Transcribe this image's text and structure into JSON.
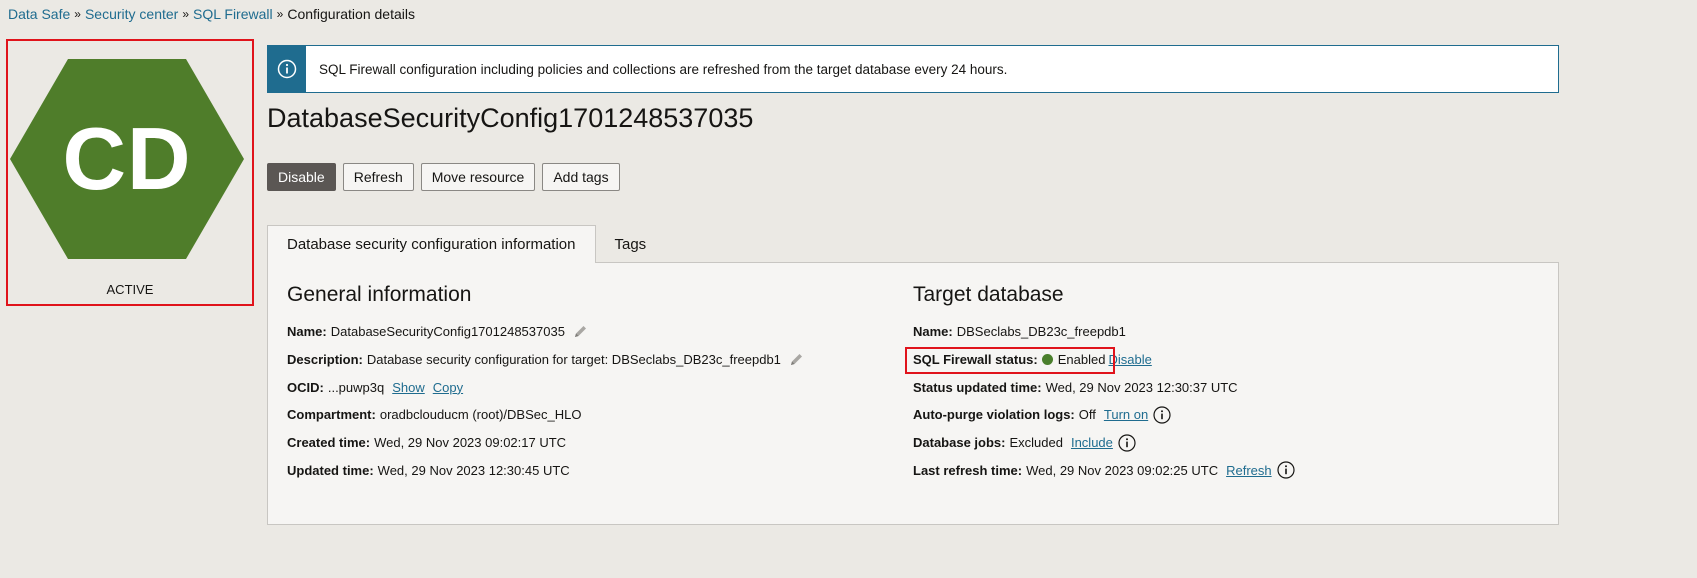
{
  "breadcrumb": {
    "items": [
      "Data Safe",
      "Security center",
      "SQL Firewall"
    ],
    "current": "Configuration details",
    "separator": "»"
  },
  "resource": {
    "initials": "CD",
    "status": "ACTIVE",
    "color": "#4f7d2a"
  },
  "banner": {
    "message": "SQL Firewall configuration including policies and collections are refreshed from the target database every 24 hours."
  },
  "page": {
    "title": "DatabaseSecurityConfig1701248537035"
  },
  "actions": {
    "disable": "Disable",
    "refresh": "Refresh",
    "move_resource": "Move resource",
    "add_tags": "Add tags"
  },
  "tabs": {
    "info": "Database security configuration information",
    "tags": "Tags"
  },
  "general": {
    "heading": "General information",
    "name_label": "Name:",
    "name_value": "DatabaseSecurityConfig1701248537035",
    "description_label": "Description:",
    "description_value": "Database security configuration for target: DBSeclabs_DB23c_freepdb1",
    "ocid_label": "OCID:",
    "ocid_value": "...puwp3q",
    "ocid_show": "Show",
    "ocid_copy": "Copy",
    "compartment_label": "Compartment:",
    "compartment_value": "oradbclouducm (root)/DBSec_HLO",
    "created_label": "Created time:",
    "created_value": "Wed, 29 Nov 2023 09:02:17 UTC",
    "updated_label": "Updated time:",
    "updated_value": "Wed, 29 Nov 2023 12:30:45 UTC"
  },
  "target": {
    "heading": "Target database",
    "name_label": "Name:",
    "name_value": "DBSeclabs_DB23c_freepdb1",
    "fw_status_label": "SQL Firewall status:",
    "fw_status_value": "Enabled",
    "fw_status_action": "Disable",
    "fw_status_color": "#4a7f2c",
    "status_updated_label": "Status updated time:",
    "status_updated_value": "Wed, 29 Nov 2023 12:30:37 UTC",
    "autopurge_label": "Auto-purge violation logs:",
    "autopurge_value": "Off",
    "autopurge_action": "Turn on",
    "jobs_label": "Database jobs:",
    "jobs_value": "Excluded",
    "jobs_action": "Include",
    "last_refresh_label": "Last refresh time:",
    "last_refresh_value": "Wed, 29 Nov 2023 09:02:25 UTC",
    "last_refresh_action": "Refresh"
  }
}
